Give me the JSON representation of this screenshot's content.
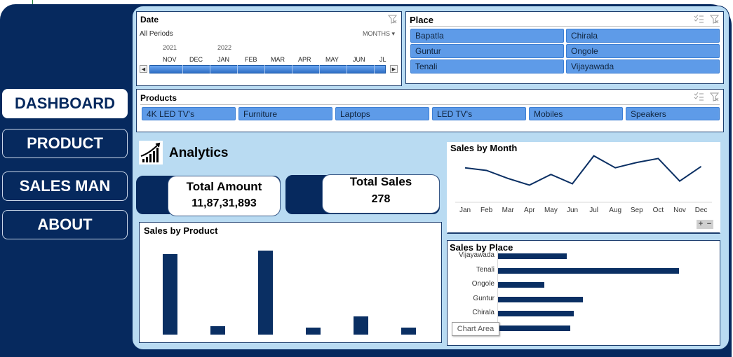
{
  "nav": {
    "dashboard": "DASHBOARD",
    "product": "PRODUCT",
    "sales_man": "SALES MAN",
    "about": "ABOUT"
  },
  "date_slicer": {
    "title": "Date",
    "period": "All Periods",
    "granularity": "MONTHS",
    "years": [
      "2021",
      "2022"
    ],
    "months": [
      "NOV",
      "DEC",
      "JAN",
      "FEB",
      "MAR",
      "APR",
      "MAY",
      "JUN",
      "JL"
    ]
  },
  "place_slicer": {
    "title": "Place",
    "items": [
      "Bapatla",
      "Chirala",
      "Guntur",
      "Ongole",
      "Tenali",
      "Vijayawada"
    ]
  },
  "products_slicer": {
    "title": "Products",
    "items": [
      "4K LED TV's",
      "Furniture",
      "Laptops",
      "LED TV's",
      "Mobiles",
      "Speakers"
    ]
  },
  "analytics": {
    "title": "Analytics",
    "icon": "growth-chart-icon"
  },
  "kpis": {
    "total_amount_label": "Total Amount",
    "total_amount_value": "11,87,31,893",
    "total_sales_label": "Total Sales",
    "total_sales_value": "278"
  },
  "sales_by_month": {
    "title": "Sales by Month",
    "zoom_controls": [
      "+",
      "−"
    ]
  },
  "sales_by_product": {
    "title": "Sales by Product"
  },
  "sales_by_place": {
    "title": "Sales by Place",
    "tooltip": "Chart Area"
  },
  "colors": {
    "navy": "#06295e",
    "panel": "#b9dbf2",
    "chip": "#5e9be8"
  },
  "chart_data": [
    {
      "type": "line",
      "title": "Sales by Month",
      "x": [
        "Jan",
        "Feb",
        "Mar",
        "Apr",
        "May",
        "Jun",
        "Jul",
        "Aug",
        "Sep",
        "Oct",
        "Nov",
        "Dec"
      ],
      "values": [
        27,
        25,
        19,
        14,
        22,
        15,
        36,
        27,
        31,
        34,
        17,
        28
      ],
      "ylim": [
        0,
        40
      ],
      "grid": false
    },
    {
      "type": "bar",
      "title": "Sales by Product",
      "values": [
        48,
        5,
        50,
        4,
        11,
        4
      ],
      "ylim": [
        0,
        55
      ],
      "grid": false
    },
    {
      "type": "bar",
      "orientation": "horizontal",
      "title": "Sales by Place",
      "categories": [
        "Vijayawada",
        "Tenali",
        "Ongole",
        "Guntur",
        "Chirala",
        ""
      ],
      "values": [
        37,
        98,
        25,
        46,
        41,
        39
      ],
      "xlim": [
        0,
        110
      ],
      "grid": false
    }
  ]
}
